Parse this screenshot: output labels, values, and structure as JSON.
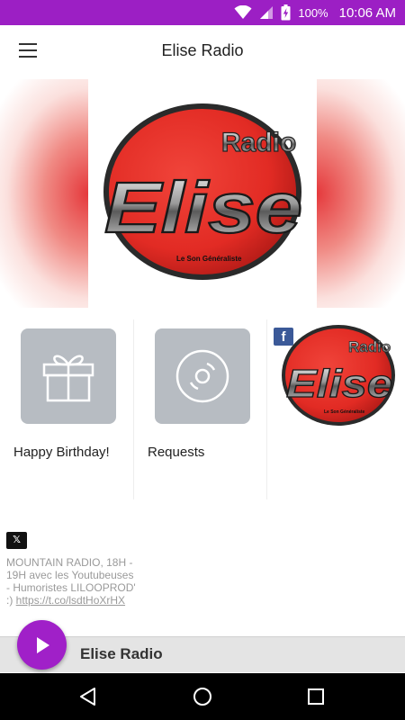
{
  "status_bar": {
    "battery_percent": "100%",
    "time": "10:06 AM",
    "icons": [
      "wifi-icon",
      "signal-icon",
      "battery-charging-icon"
    ],
    "background_color": "#9c1fc4"
  },
  "app_bar": {
    "title": "Elise Radio",
    "menu_icon": "hamburger-menu-icon"
  },
  "logo": {
    "brand_word": "Elise",
    "radio_word": "Radio",
    "tagline": "Le Son Généraliste",
    "circle_color": "#e5332a"
  },
  "tiles": [
    {
      "label": "Happy Birthday!",
      "icon": "gift-icon"
    },
    {
      "label": "Requests",
      "icon": "disc-icon"
    }
  ],
  "facebook": {
    "badge": "f",
    "icon": "facebook-icon"
  },
  "twitter": {
    "badge": "𝕏",
    "tweet_text": "MOUNTAIN RADIO, 18H - 19H avec les Youtubeuses - Humoristes LILOOPROD' :) ",
    "tweet_link": "https://t.co/lsdtHoXrHX"
  },
  "player": {
    "title": "Elise Radio",
    "accent_color": "#a020c8"
  },
  "nav_bar": {
    "buttons": [
      "back-icon",
      "home-icon",
      "recents-icon"
    ]
  }
}
